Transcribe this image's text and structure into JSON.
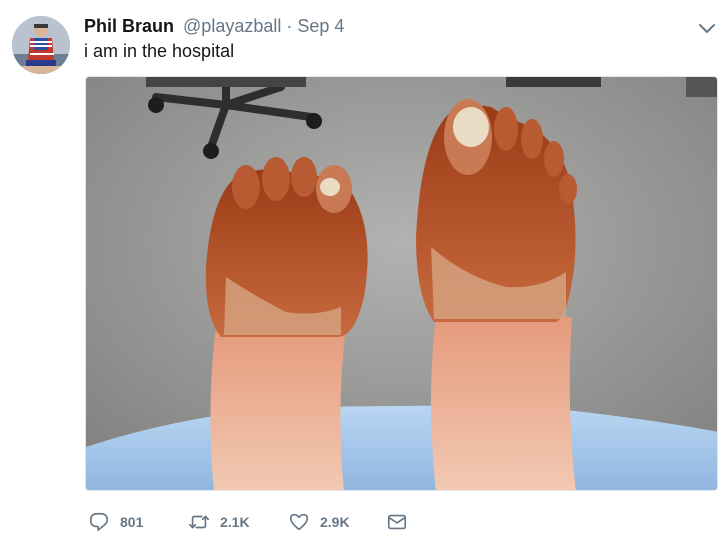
{
  "tweet": {
    "author_name": "Phil Braun",
    "author_handle": "@playazball",
    "separator": "·",
    "date": "Sep 4",
    "text": "i am in the hospital"
  },
  "actions": {
    "replies": "801",
    "retweets": "2.1K",
    "likes": "2.9K"
  },
  "icons": {
    "menu": "chevron-down-icon",
    "reply": "reply-icon",
    "retweet": "retweet-icon",
    "like": "heart-icon",
    "dm": "envelope-icon"
  },
  "colors": {
    "text": "#14171a",
    "secondary": "#657786"
  }
}
